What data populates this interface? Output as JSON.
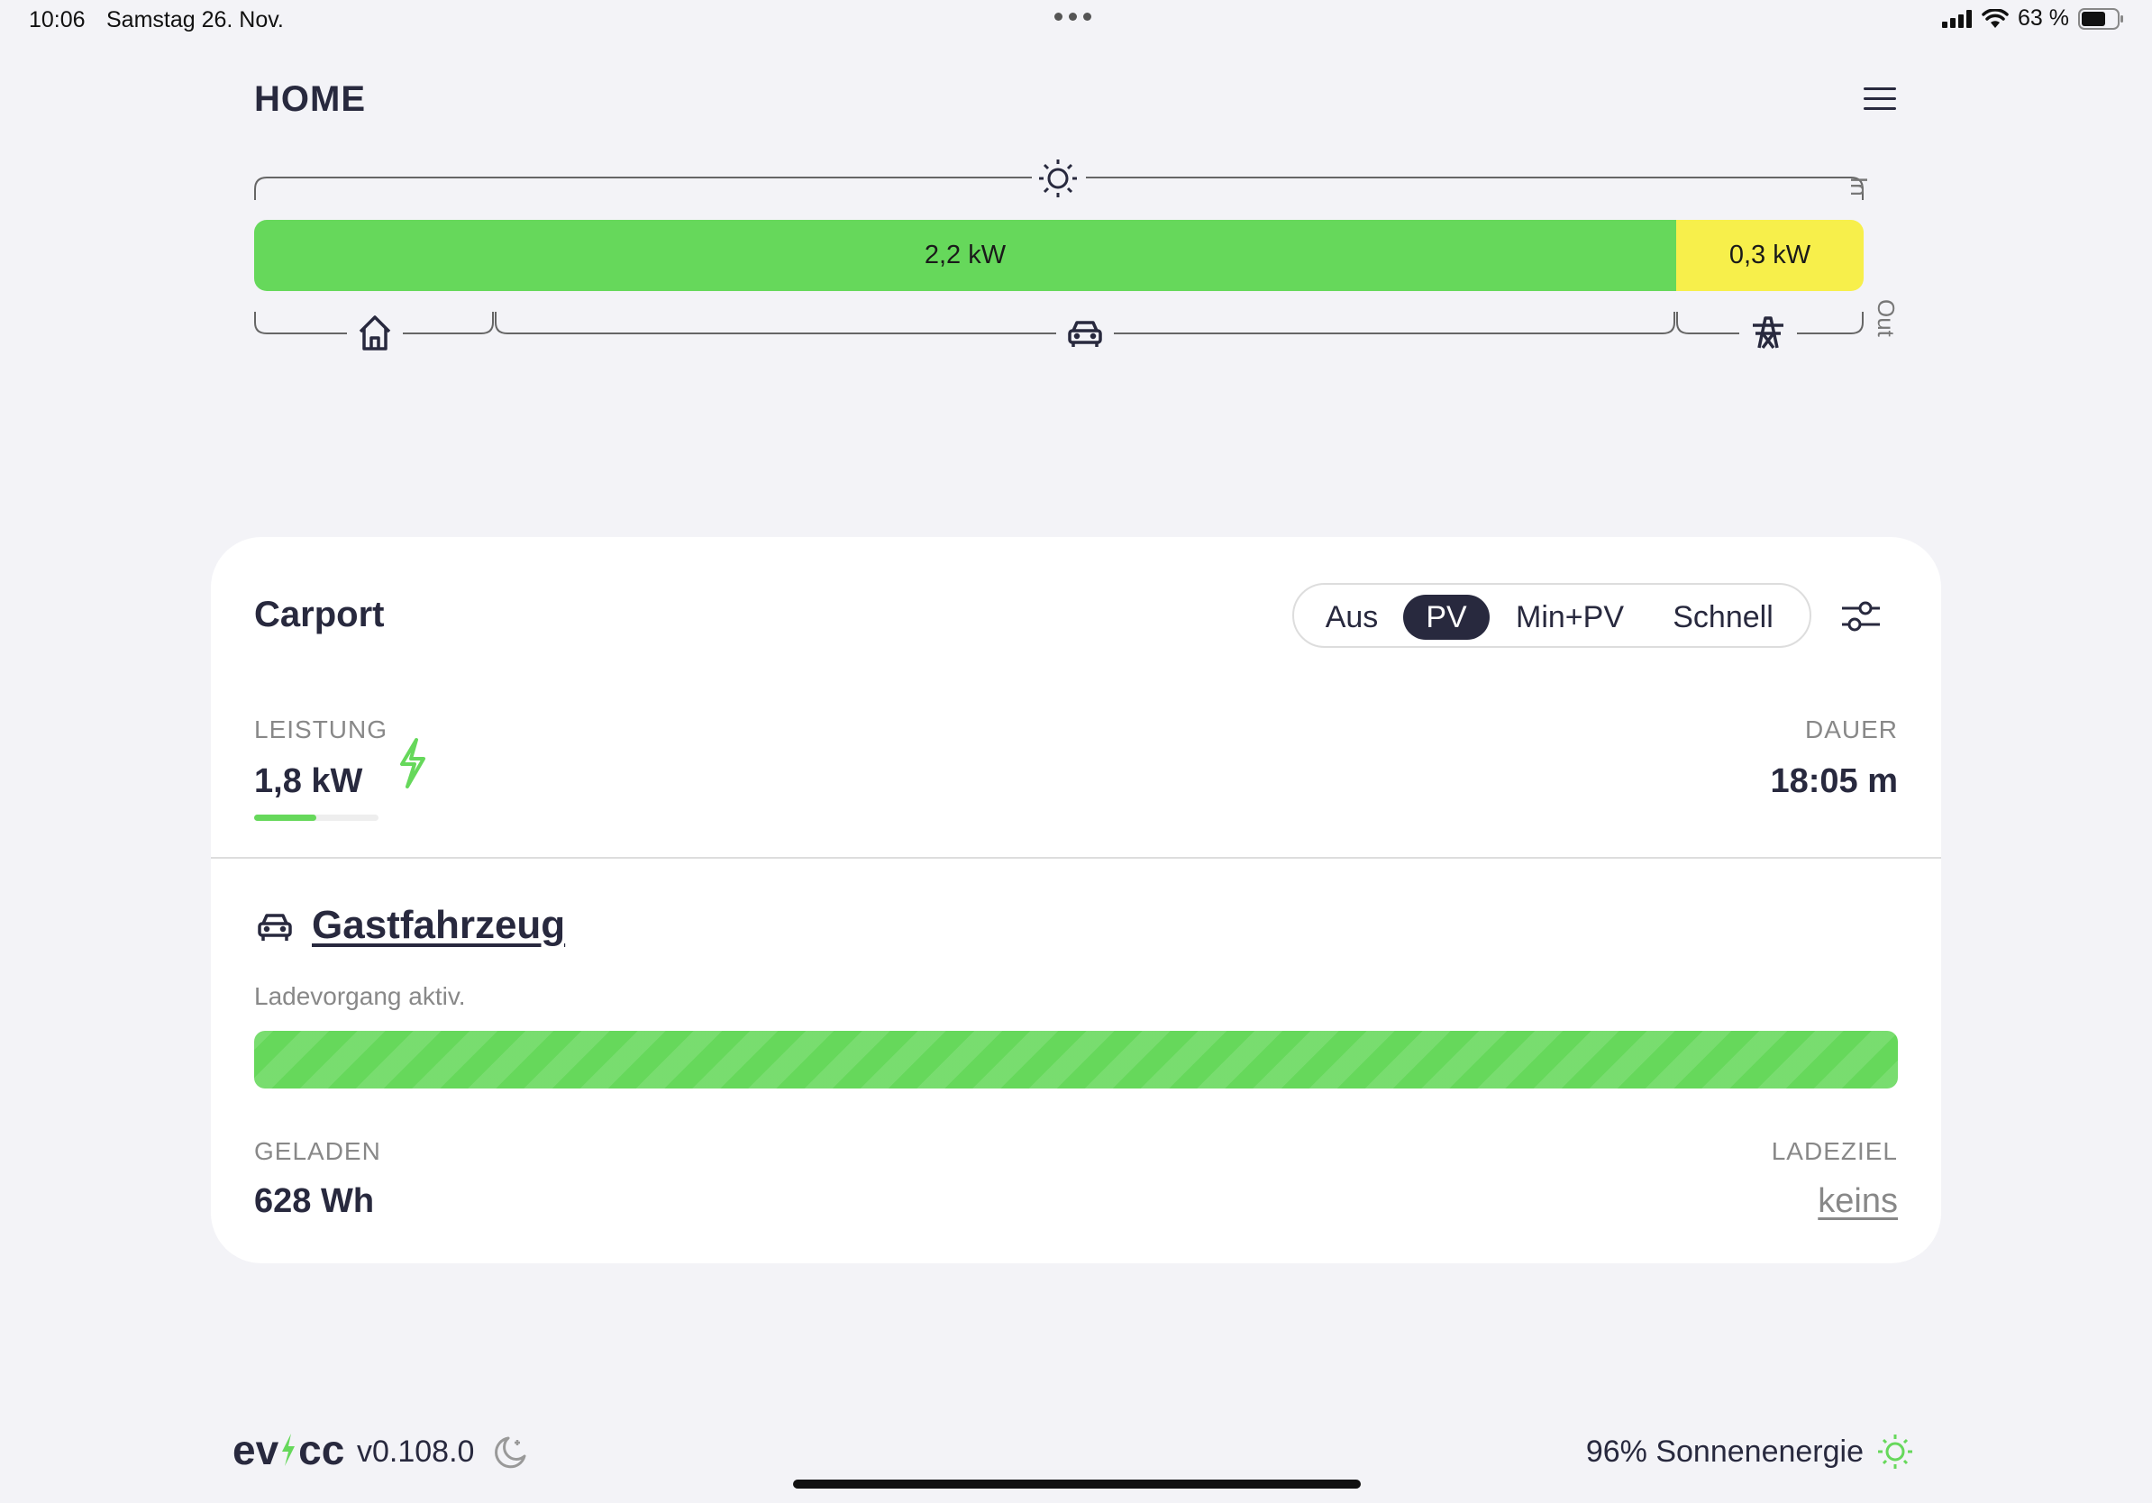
{
  "status_bar": {
    "time": "10:06",
    "date": "Samstag 26. Nov.",
    "battery": "63 %"
  },
  "header": {
    "title": "HOME",
    "menu_icon": "hamburger-menu-icon"
  },
  "energyflow": {
    "pv_power": "2,2 kW",
    "grid_power": "0,3 kW",
    "label_in": "In",
    "label_out": "Out",
    "pv_share": 0.884,
    "grid_share": 0.116,
    "colors": {
      "pv": "#66d85b",
      "grid": "#f7ef4b"
    }
  },
  "loadpoint": {
    "title": "Carport",
    "modes": [
      "Aus",
      "PV",
      "Min+PV",
      "Schnell"
    ],
    "active_mode": "PV",
    "power_label": "LEISTUNG",
    "power_value": "1,8 kW",
    "power_fraction": 0.5,
    "duration_label": "DAUER",
    "duration_value": "18:05 m",
    "vehicle_name": "Gastfahrzeug",
    "vehicle_status": "Ladevorgang aktiv.",
    "charged_label": "GELADEN",
    "charged_value": "628 Wh",
    "target_label": "LADEZIEL",
    "target_value": "keins"
  },
  "footer": {
    "logo_ev": "ev",
    "logo_cc": "cc",
    "version": "v0.108.0",
    "solar_share": "96% Sonnenenergie"
  }
}
